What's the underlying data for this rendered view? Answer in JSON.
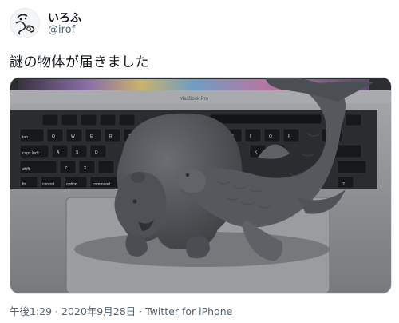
{
  "author": {
    "display_name": "いろふ",
    "handle": "@irof"
  },
  "tweet": {
    "text": "謎の物体が届きました",
    "media": {
      "laptop_label": "MacBook Pro",
      "keys": [
        "tab",
        "Q",
        "W",
        "E",
        "R",
        "T",
        "U",
        "I",
        "O",
        "P",
        "caps lock",
        "A",
        "S",
        "D",
        "K",
        "L",
        "shift",
        "Z",
        "X",
        "control",
        "option",
        "command",
        "fn",
        "?"
      ]
    }
  },
  "timestamp": {
    "time": "午後1:29",
    "separator": " · ",
    "date": "2020年9月28日",
    "client": "Twitter for iPhone"
  },
  "colors": {
    "text_primary": "#0f1419",
    "text_secondary": "#536471",
    "laptop_gray": "#8e8f92",
    "keyboard_black": "#1c1d20",
    "figure_gray": "#55585c"
  }
}
